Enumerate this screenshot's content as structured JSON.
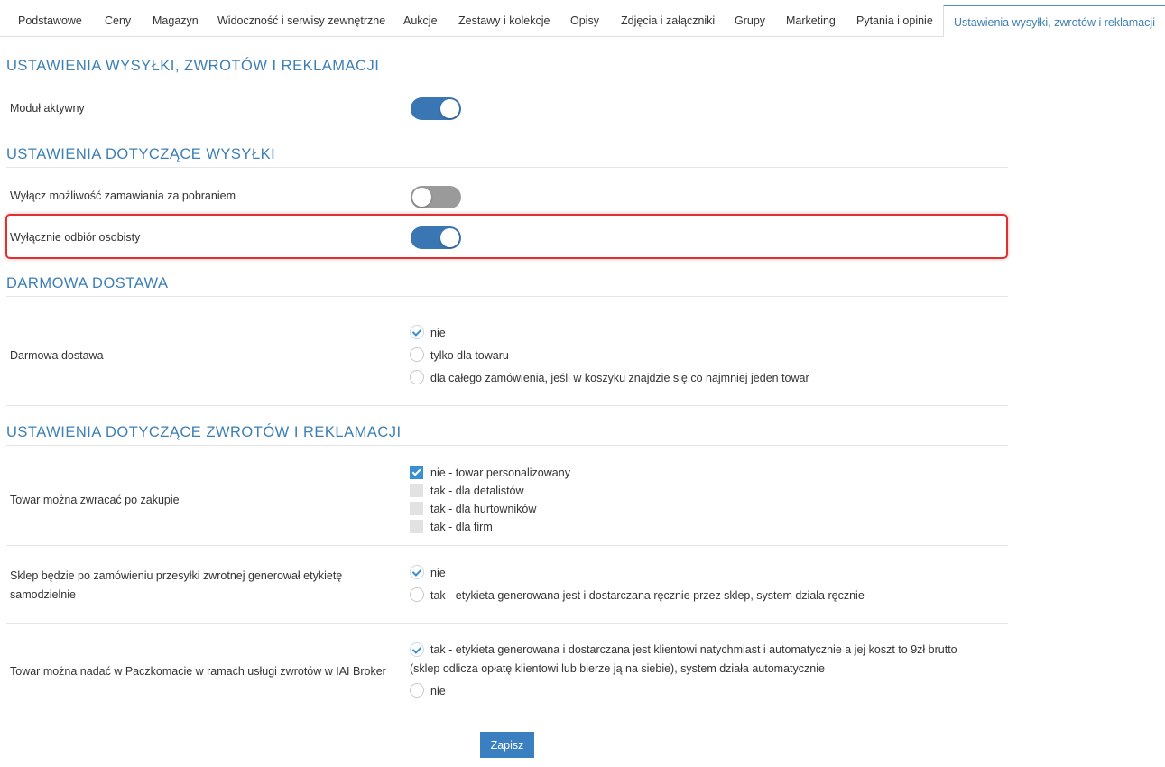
{
  "tabs": [
    {
      "label": "Podstawowe"
    },
    {
      "label": "Ceny"
    },
    {
      "label": "Magazyn"
    },
    {
      "label": "Widoczność i serwisy zewnętrzne"
    },
    {
      "label": "Aukcje"
    },
    {
      "label": "Zestawy i kolekcje"
    },
    {
      "label": "Opisy"
    },
    {
      "label": "Zdjęcia i załączniki"
    },
    {
      "label": "Grupy"
    },
    {
      "label": "Marketing"
    },
    {
      "label": "Pytania i opinie"
    },
    {
      "label": "Ustawienia wysyłki, zwrotów i reklamacji",
      "active": true
    }
  ],
  "section_main": {
    "title": "USTAWIENIA WYSYŁKI, ZWROTÓW I REKLAMACJI",
    "module_active_label": "Moduł aktywny",
    "module_active_on": true
  },
  "section_shipping": {
    "title": "USTAWIENIA DOTYCZĄCE WYSYŁKI",
    "cod_disable_label": "Wyłącz możliwość zamawiania za pobraniem",
    "cod_disable_on": false,
    "pickup_only_label": "Wyłącznie odbiór osobisty",
    "pickup_only_on": true
  },
  "section_free": {
    "title": "DARMOWA DOSTAWA",
    "label": "Darmowa dostawa",
    "options": [
      {
        "label": "nie",
        "checked": true
      },
      {
        "label": "tylko dla towaru",
        "checked": false
      },
      {
        "label": "dla całego zamówienia, jeśli w koszyku znajdzie się co najmniej jeden towar",
        "checked": false
      }
    ]
  },
  "section_returns": {
    "title": "USTAWIENIA DOTYCZĄCE ZWROTÓW I REKLAMACJI",
    "returnable_label": "Towar można zwracać po zakupie",
    "returnable_options": [
      {
        "label": "nie - towar personalizowany",
        "checked": true
      },
      {
        "label": "tak - dla detalistów",
        "checked": false
      },
      {
        "label": "tak - dla hurtowników",
        "checked": false
      },
      {
        "label": "tak - dla firm",
        "checked": false
      }
    ],
    "label_gen_label": "Sklep będzie po zamówieniu przesyłki zwrotnej generował etykietę samodzielnie",
    "label_gen_options": [
      {
        "label": "nie",
        "checked": true
      },
      {
        "label": "tak - etykieta generowana jest i dostarczana ręcznie przez sklep, system działa ręcznie",
        "checked": false
      }
    ],
    "paczkomat_label": "Towar można nadać w Paczkomacie w ramach usługi zwrotów w IAI Broker",
    "paczkomat_options": [
      {
        "label": "tak - etykieta generowana i dostarczana jest klientowi natychmiast i automatycznie a jej koszt to 9zł brutto (sklep odlicza opłatę klientowi lub bierze ją na siebie), system działa automatycznie",
        "checked": true
      },
      {
        "label": "nie",
        "checked": false
      }
    ]
  },
  "save_label": "Zapisz",
  "colors": {
    "accent": "#3c7fb5",
    "toggle_on": "#3a76b4",
    "toggle_off": "#9a9a9a",
    "highlight": "#e03030",
    "save_button": "#3a7fc0"
  }
}
